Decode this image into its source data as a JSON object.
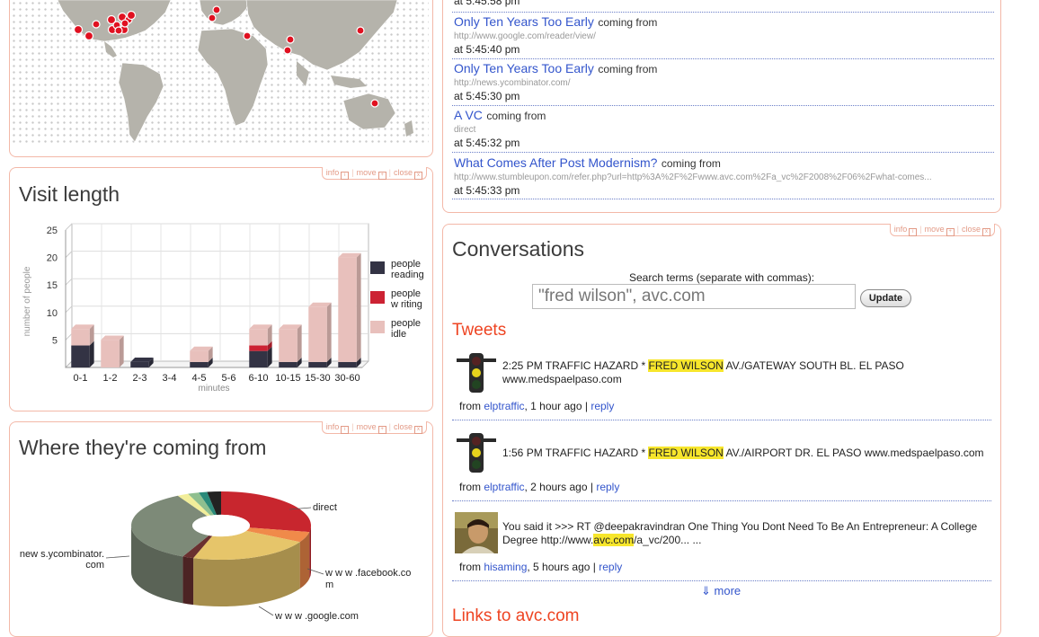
{
  "panel_tools": {
    "info": "info",
    "move": "move",
    "close": "close",
    "info_box": "i",
    "move_box": "+",
    "close_box": "x"
  },
  "visit_length": {
    "title": "Visit length"
  },
  "chart_data": [
    {
      "type": "bar",
      "title": "Visit length",
      "xlabel": "minutes",
      "ylabel": "number of people",
      "ylim": [
        0,
        25
      ],
      "yticks": [
        5,
        10,
        15,
        20,
        25
      ],
      "categories": [
        "0-1",
        "1-2",
        "2-3",
        "3-4",
        "4-5",
        "5-6",
        "6-10",
        "10-15",
        "15-30",
        "30-60"
      ],
      "series": [
        {
          "name": "people reading",
          "color": "#333344",
          "values": [
            4,
            0,
            1,
            0,
            1,
            0,
            3,
            1,
            1,
            1
          ]
        },
        {
          "name": "people w riting",
          "color": "#cc2233",
          "values": [
            0,
            0,
            0,
            0,
            0,
            0,
            1,
            0,
            0,
            0
          ]
        },
        {
          "name": "people idle",
          "color": "#e8c0bc",
          "values": [
            3,
            5,
            0,
            0,
            2,
            0,
            3,
            6,
            10,
            19
          ]
        }
      ],
      "legend_position": "right",
      "grid": true
    },
    {
      "type": "pie",
      "title": "Where they're coming from",
      "labels": [
        "direct",
        "www.facebook.com",
        "www.google.com",
        "news.ycombinator.com"
      ],
      "label_text": [
        "direct",
        "w w w .facebook.co",
        "m",
        "w w w .google.com",
        "new s.ycombinator.",
        "com"
      ],
      "slices": [
        {
          "label": "direct",
          "value": 28,
          "color": "#c8262e"
        },
        {
          "label": "www.facebook.com",
          "value": 5,
          "color": "#f08a4a"
        },
        {
          "label": "www.google.com",
          "value": 22,
          "color": "#e6c56a"
        },
        {
          "label": "other-1",
          "value": 2,
          "color": "#6a3030"
        },
        {
          "label": "news.ycombinator.com",
          "value": 35,
          "color": "#7d8a78"
        },
        {
          "label": "other-2",
          "value": 2,
          "color": "#f2ee9a"
        },
        {
          "label": "other-3",
          "value": 2,
          "color": "#8fbf8f"
        },
        {
          "label": "other-4",
          "value": 1.5,
          "color": "#2a8a7a"
        },
        {
          "label": "other-5",
          "value": 2.5,
          "color": "#222222"
        }
      ]
    }
  ],
  "where_from": {
    "title": "Where they're coming from"
  },
  "visits": [
    {
      "at": "at 5:45:58 pm"
    },
    {
      "title": "Only Ten Years Too Early",
      "coming_from": "coming from",
      "source": "http://www.google.com/reader/view/",
      "at": "at 5:45:40 pm"
    },
    {
      "title": "Only Ten Years Too Early",
      "coming_from": "coming from",
      "source": "http://news.ycombinator.com/",
      "at": "at 5:45:30 pm"
    },
    {
      "title": "A VC",
      "coming_from": "coming from",
      "source": "direct",
      "at": "at 5:45:32 pm"
    },
    {
      "title": "What Comes After Post Modernism?",
      "coming_from": "coming from",
      "source": "http://www.stumbleupon.com/refer.php?url=http%3A%2F%2Fwww.avc.com%2Fa_vc%2F2008%2F06%2Fwhat-comes...",
      "at": "at 5:45:33 pm"
    }
  ],
  "conversations": {
    "title": "Conversations",
    "search_label": "Search terms (separate with commas):",
    "search_value": "\"fred wilson\", avc.com",
    "update_label": "Update",
    "tweets_title": "Tweets",
    "links_title": "Links to avc.com",
    "more_label": "more",
    "more_icon": "⇓",
    "tweets": [
      {
        "pre": "2:25 PM TRAFFIC HAZARD * ",
        "hl": "FRED WILSON",
        "post": " AV./GATEWAY SOUTH BL. EL PASO www.medspaelpaso.com",
        "from": "from",
        "user": "elptraffic",
        "ago": ", 1 hour ago | ",
        "reply": "reply",
        "avatar": "traffic-light-icon"
      },
      {
        "pre": "1:56 PM TRAFFIC HAZARD * ",
        "hl": "FRED WILSON",
        "post": " AV./AIRPORT DR. EL PASO www.medspaelpaso.com",
        "from": "from",
        "user": "elptraffic",
        "ago": ", 2 hours ago | ",
        "reply": "reply",
        "avatar": "traffic-light-icon"
      },
      {
        "pre": "You said it >>> RT @deepakravindran One Thing You Dont Need To Be An Entrepreneur: A College Degree http://www.",
        "hl": "avc.com",
        "post": "/a_vc/200... ...",
        "from": "from",
        "user": "hisaming",
        "ago": ", 5 hours ago | ",
        "reply": "reply",
        "avatar": "user-photo"
      }
    ]
  }
}
